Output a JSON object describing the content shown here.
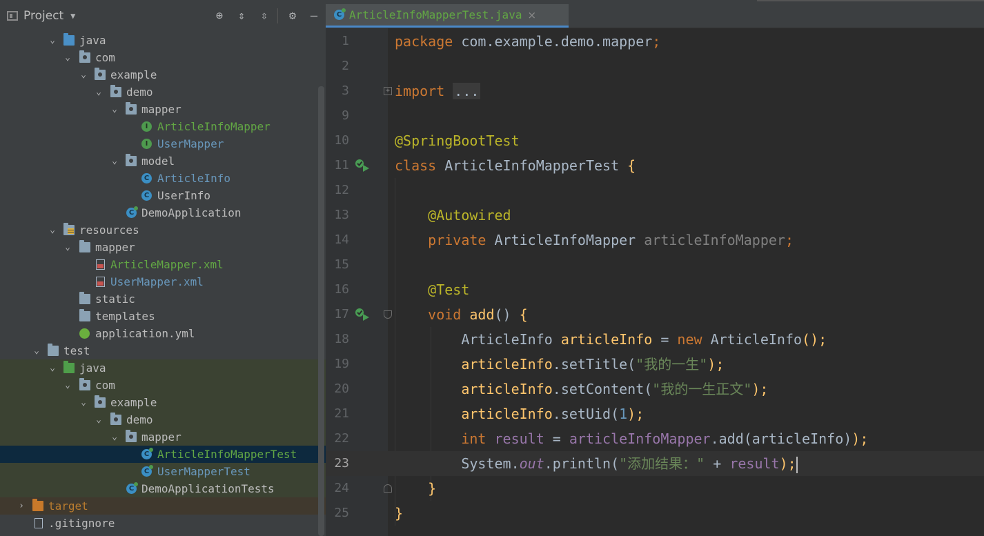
{
  "project_panel": {
    "title": "Project",
    "icons": [
      "locate-icon",
      "expand-all-icon",
      "collapse-all-icon",
      "gear-icon",
      "minimize-icon"
    ]
  },
  "tree": [
    {
      "label": "java",
      "kind": "src-folder"
    },
    {
      "label": "com",
      "kind": "package"
    },
    {
      "label": "example",
      "kind": "package"
    },
    {
      "label": "demo",
      "kind": "package"
    },
    {
      "label": "mapper",
      "kind": "package"
    },
    {
      "label": "ArticleInfoMapper",
      "kind": "interface"
    },
    {
      "label": "UserMapper",
      "kind": "interface"
    },
    {
      "label": "model",
      "kind": "package"
    },
    {
      "label": "ArticleInfo",
      "kind": "class"
    },
    {
      "label": "UserInfo",
      "kind": "class"
    },
    {
      "label": "DemoApplication",
      "kind": "spring-class"
    },
    {
      "label": "resources",
      "kind": "resources-folder"
    },
    {
      "label": "mapper",
      "kind": "folder"
    },
    {
      "label": "ArticleMapper.xml",
      "kind": "xml"
    },
    {
      "label": "UserMapper.xml",
      "kind": "xml"
    },
    {
      "label": "static",
      "kind": "folder"
    },
    {
      "label": "templates",
      "kind": "folder"
    },
    {
      "label": "application.yml",
      "kind": "yml"
    },
    {
      "label": "test",
      "kind": "folder"
    },
    {
      "label": "java",
      "kind": "test-src-folder"
    },
    {
      "label": "com",
      "kind": "package"
    },
    {
      "label": "example",
      "kind": "package"
    },
    {
      "label": "demo",
      "kind": "package"
    },
    {
      "label": "mapper",
      "kind": "package"
    },
    {
      "label": "ArticleInfoMapperTest",
      "kind": "test-class"
    },
    {
      "label": "UserMapperTest",
      "kind": "test-class"
    },
    {
      "label": "DemoApplicationTests",
      "kind": "test-class"
    },
    {
      "label": "target",
      "kind": "excluded-folder"
    },
    {
      "label": ".gitignore",
      "kind": "file"
    }
  ],
  "editor": {
    "tab_label": "ArticleInfoMapperTest.java",
    "tab_close": "×",
    "current_line": "23",
    "line_numbers": [
      "1",
      "2",
      "3",
      "9",
      "10",
      "11",
      "12",
      "13",
      "14",
      "15",
      "16",
      "17",
      "18",
      "19",
      "20",
      "21",
      "22",
      "23",
      "24",
      "25"
    ],
    "code": {
      "package_kw": "package",
      "package_name": " com.example.demo.mapper",
      "semicolon": ";",
      "import_kw": "import",
      "import_fold": "...",
      "ann_sbt": "@SpringBootTest",
      "class_kw": "class",
      "class_name": " ArticleInfoMapperTest ",
      "brace_open": "{",
      "ann_autowired": "@Autowired",
      "private_kw": "private",
      "field_type": " ArticleInfoMapper ",
      "field_name": "articleInfoMapper",
      "ann_test": "@Test",
      "void_kw": "void",
      "method_name": "add",
      "parens": "()",
      "l18_type": "ArticleInfo ",
      "l18_var": "articleInfo",
      "l18_eq": " = ",
      "new_kw": "new",
      "l18_ctor": " ArticleInfo",
      "l18_tail": "();",
      "l19_a": "articleInfo",
      "l19_b": ".setTitle(",
      "l19_str": "\"我的一生\"",
      "l19_c": ");",
      "l20_b": ".setContent(",
      "l20_str": "\"我的一生正文\"",
      "l21_b": ".setUid(",
      "l21_num": "1",
      "int_kw": "int",
      "result_var": "result",
      "l22_eq": " = ",
      "l22_mapper": "articleInfoMapper",
      "l22_call": ".add(articleInfo)",
      "l23_sys": "System.",
      "l23_out": "out",
      "l23_print": ".println(",
      "l23_str": "\"添加结果：\"",
      "l23_plus": " + ",
      "l23_end": ");",
      "brace_close": "}"
    }
  }
}
